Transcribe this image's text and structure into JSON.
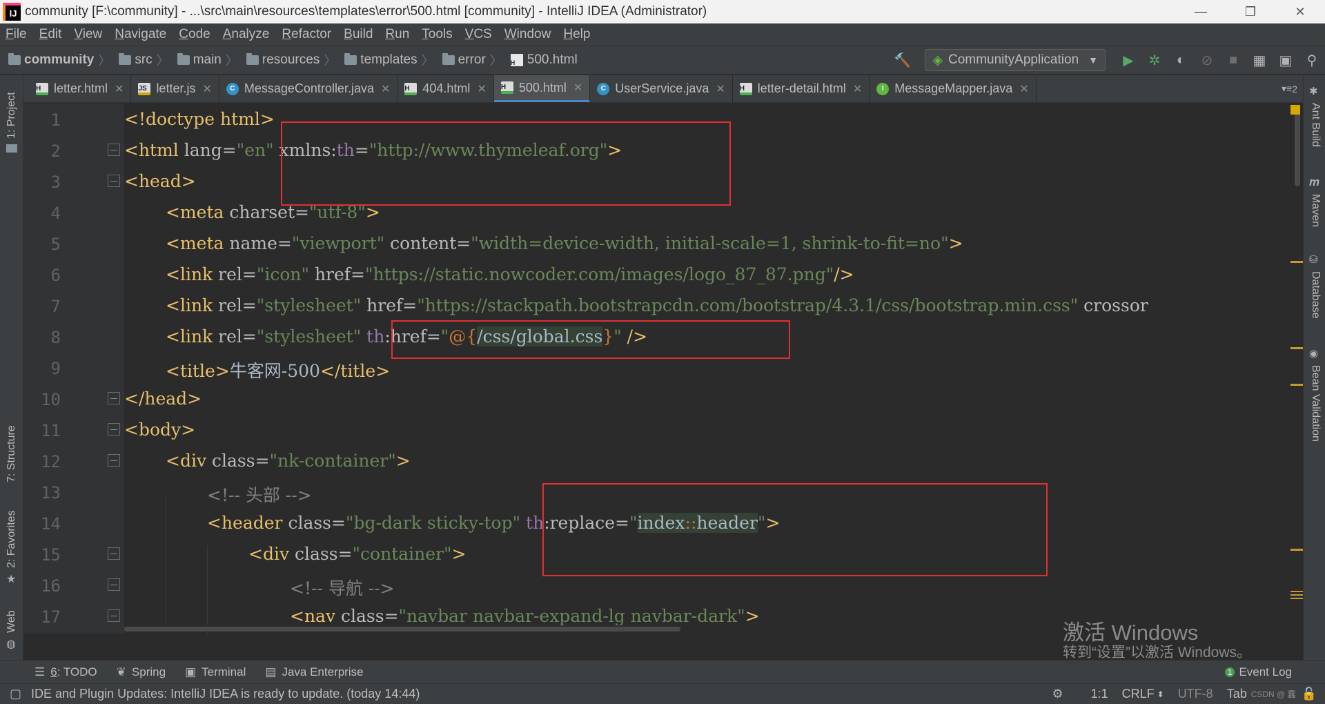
{
  "window": {
    "title": "community [F:\\community] - ...\\src\\main\\resources\\templates\\error\\500.html [community] - IntelliJ IDEA (Administrator)",
    "logo_text": "IJ",
    "minimize": "—",
    "restore": "❐",
    "close": "✕"
  },
  "menu": [
    "File",
    "Edit",
    "View",
    "Navigate",
    "Code",
    "Analyze",
    "Refactor",
    "Build",
    "Run",
    "Tools",
    "VCS",
    "Window",
    "Help"
  ],
  "breadcrumb": [
    "community",
    "src",
    "main",
    "resources",
    "templates",
    "error",
    "500.html"
  ],
  "run_config": "CommunityApplication",
  "tabs": [
    {
      "label": "letter.html",
      "icon": "html"
    },
    {
      "label": "letter.js",
      "icon": "js"
    },
    {
      "label": "MessageController.java",
      "icon": "class"
    },
    {
      "label": "404.html",
      "icon": "html"
    },
    {
      "label": "500.html",
      "icon": "html",
      "active": true
    },
    {
      "label": "UserService.java",
      "icon": "class"
    },
    {
      "label": "letter-detail.html",
      "icon": "html"
    },
    {
      "label": "MessageMapper.java",
      "icon": "interface"
    }
  ],
  "tabs_overflow": "2",
  "left_tools": {
    "project": "1: Project",
    "structure": "7: Structure",
    "favorites": "2: Favorites",
    "web": "Web"
  },
  "right_tools": {
    "ant": "Ant Build",
    "maven": "Maven",
    "database": "Database",
    "bean": "Bean Validation"
  },
  "line_numbers": [
    "1",
    "2",
    "3",
    "4",
    "5",
    "6",
    "7",
    "8",
    "9",
    "10",
    "11",
    "12",
    "13",
    "14",
    "15",
    "16",
    "17"
  ],
  "code": {
    "l1": "<!doctype html>",
    "l2a": "<html ",
    "l2b": "lang=",
    "l2c": "\"en\" ",
    "l2d": "xmlns:",
    "l2e": "th",
    "l2f": "=",
    "l2g": "\"http://www.thymeleaf.org\"",
    "l2h": ">",
    "l3": "<head>",
    "l4a": "<meta ",
    "l4b": "charset=",
    "l4c": "\"utf-8\"",
    "l4d": ">",
    "l5a": "<meta ",
    "l5b": "name=",
    "l5c": "\"viewport\" ",
    "l5d": "content=",
    "l5e": "\"width=device-width, initial-scale=1, shrink-to-fit=no\"",
    "l5f": ">",
    "l6a": "<link ",
    "l6b": "rel=",
    "l6c": "\"icon\" ",
    "l6d": "href=",
    "l6e": "\"https://static.nowcoder.com/images/logo_87_87.png\"",
    "l6f": "/>",
    "l7a": "<link ",
    "l7b": "rel=",
    "l7c": "\"stylesheet\" ",
    "l7d": "href=",
    "l7e": "\"https://stackpath.bootstrapcdn.com/bootstrap/4.3.1/css/bootstrap.min.css\" ",
    "l7f": "crossor",
    "l8a": "<link ",
    "l8b": "rel=",
    "l8c": "\"stylesheet\" ",
    "l8d": "th",
    "l8e": ":href=",
    "l8f": "\"",
    "l8g": "@{",
    "l8h": "/css/global.css",
    "l8i": "}",
    "l8j": "\" ",
    "l8k": "/>",
    "l9a": "<title>",
    "l9b": "牛客网-500",
    "l9c": "</title>",
    "l10": "</head>",
    "l11": "<body>",
    "l12a": "<div ",
    "l12b": "class=",
    "l12c": "\"nk-container\"",
    "l12d": ">",
    "l13": "<!-- 头部 -->",
    "l14a": "<header ",
    "l14b": "class=",
    "l14c": "\"bg-dark sticky-top\" ",
    "l14d": "th",
    "l14e": ":replace=",
    "l14f": "\"",
    "l14g": "index",
    "l14h": "::",
    "l14i": "header",
    "l14j": "\"",
    "l14k": ">",
    "l15a": "<div ",
    "l15b": "class=",
    "l15c": "\"container\"",
    "l15d": ">",
    "l16": "<!-- 导航 -->",
    "l17a": "<nav ",
    "l17b": "class=",
    "l17c": "\"navbar navbar-expand-lg navbar-dark\"",
    "l17d": ">"
  },
  "bottom_tools": [
    {
      "num": "6",
      "label": ": TODO"
    },
    {
      "label": "Spring"
    },
    {
      "label": "Terminal"
    },
    {
      "label": "Java Enterprise"
    }
  ],
  "event_log": {
    "count": "1",
    "label": "Event Log"
  },
  "status": {
    "message": "IDE and Plugin Updates: IntelliJ IDEA is ready to update. (today 14:44)",
    "position": "1:1",
    "line_sep": "CRLF",
    "encoding": "UTF-8",
    "indent": "Tab"
  },
  "watermark": {
    "line1": "激活 Windows",
    "line2": "转到“设置”以激活 Windows。"
  },
  "csdn_mark": "CSDN @ 蠢",
  "colors": {
    "tag": "#e8bf6a",
    "string": "#6a8759",
    "comment": "#808080",
    "th_namespace": "#9876aa",
    "annotation_box": "#e03030"
  }
}
